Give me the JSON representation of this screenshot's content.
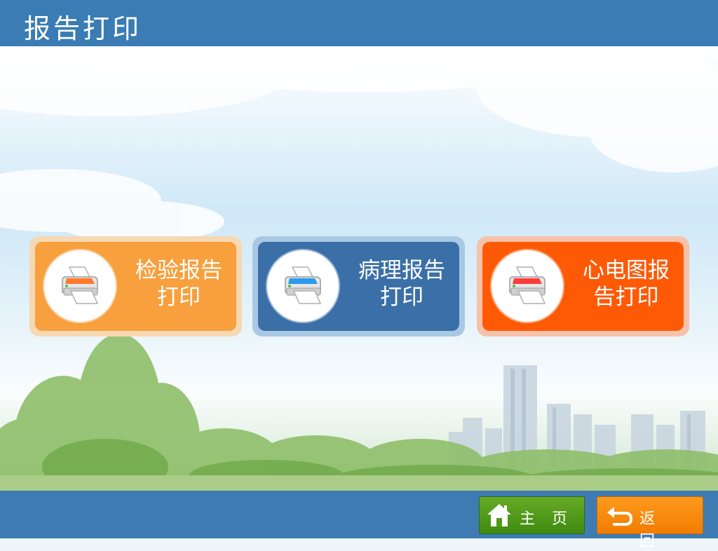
{
  "header": {
    "title": "报告打印"
  },
  "tiles": [
    {
      "line1": "检验报告",
      "line2": "打印",
      "accent": "#f7a03d",
      "printer_color": "#ff7a2a",
      "icon": "printer-icon"
    },
    {
      "line1": "病理报告",
      "line2": "打印",
      "accent": "#3b6fa7",
      "printer_color": "#2a9bf0",
      "icon": "printer-icon"
    },
    {
      "line1": "心电图报",
      "line2": "告打印",
      "accent": "#fe5a06",
      "printer_color": "#ff3c3c",
      "icon": "printer-icon"
    }
  ],
  "footer": {
    "home_label": "主页",
    "back_label": "返回",
    "home_color": "#4f9a18",
    "back_color": "#f58400"
  }
}
